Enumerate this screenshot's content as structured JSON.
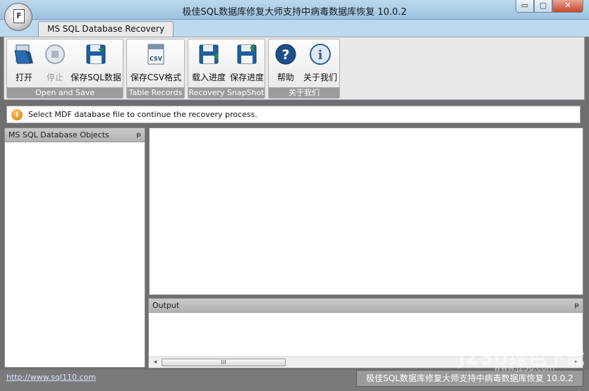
{
  "window": {
    "title": "极佳SQL数据库修复大师支持中病毒数据库恢复 10.0.2",
    "app_icon_letter": "F",
    "minimize_label": "▭",
    "maximize_label": "▢",
    "close_label": "✕"
  },
  "ribbon": {
    "tab_label": "MS SQL Database Recovery",
    "groups": [
      {
        "caption": "Open and Save",
        "buttons": [
          {
            "label": "打开",
            "icon": "folder-open-icon",
            "enabled": true
          },
          {
            "label": "停止",
            "icon": "stop-icon",
            "enabled": false
          },
          {
            "label": "保存SQL数据",
            "icon": "save-icon",
            "enabled": true
          }
        ]
      },
      {
        "caption": "Table Records",
        "buttons": [
          {
            "label": "保存CSV格式",
            "icon": "csv-icon",
            "enabled": true
          }
        ]
      },
      {
        "caption": "Recovery SnapShot",
        "buttons": [
          {
            "label": "载入进度",
            "icon": "load-snapshot-icon",
            "enabled": true
          },
          {
            "label": "保存进度",
            "icon": "save-snapshot-icon",
            "enabled": true
          }
        ]
      },
      {
        "caption": "关于我们",
        "buttons": [
          {
            "label": "帮助",
            "icon": "help-icon",
            "enabled": true
          },
          {
            "label": "关于我们",
            "icon": "info-icon",
            "enabled": true
          }
        ]
      }
    ],
    "csv_icon_text": "CSV",
    "help_icon_text": "?",
    "info_icon_text": "i"
  },
  "infobar": {
    "icon_text": "i",
    "message": "Select MDF database file to continue the recovery process."
  },
  "left_panel": {
    "title": "MS SQL Database Objects",
    "pin_label": "ᵽ"
  },
  "output_panel": {
    "title": "Output",
    "pin_label": "ᵽ",
    "scroll_left": "◂",
    "scroll_right": "▸",
    "scroll_grip": "III"
  },
  "statusbar": {
    "link": "http://www.sql110.com",
    "right_text": "极佳SQL数据库修复大师支持中病毒数据库恢复 10.0.2"
  },
  "watermark": {
    "main": "JZ5U绿色下载",
    "sub": "www.jz5u.com"
  },
  "colors": {
    "accent_blue": "#1f6fb5",
    "caption_gray": "#9c9c9c",
    "info_orange": "#e07b00"
  }
}
